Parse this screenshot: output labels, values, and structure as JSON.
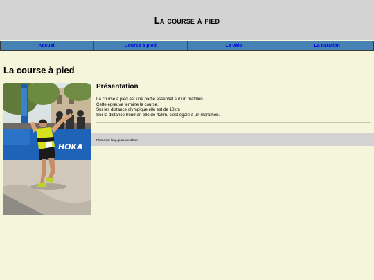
{
  "header": {
    "title": "La course à pied"
  },
  "nav": {
    "items": [
      "Accueil",
      "Course à pied",
      "Le vélo",
      "La natation"
    ]
  },
  "page": {
    "title": "La course à pied"
  },
  "section": {
    "title": "Présentation",
    "lines": [
      "La course à pied est une partie essentiel sur un triathlon.",
      "Cette épreuve termine la course.",
      "Sur les distance olympique elle est de 10km",
      "Sur la distance Ironman elle de 42km, c'est égale à un marathon."
    ]
  },
  "photo": {
    "banner_text": "HOKA"
  },
  "footer": {
    "text": "Plus c'est long, plus c'est bon"
  },
  "colors": {
    "background": "#f5f5dc",
    "header_bg": "#d3d3d3",
    "nav_bg": "#4682b4",
    "link": "#0000ee"
  }
}
